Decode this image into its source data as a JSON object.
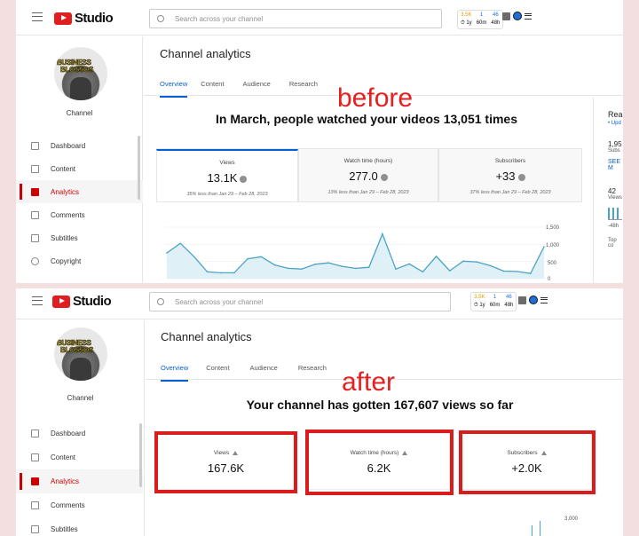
{
  "brand": {
    "logo_text": "Studio"
  },
  "search": {
    "placeholder": "Search across your channel"
  },
  "header_stats": {
    "col1": {
      "value": "3.5K",
      "sub": "⏱ 1y"
    },
    "col2": {
      "value": "1",
      "sub": "60m"
    },
    "col3": {
      "value": "46",
      "sub": "48h"
    }
  },
  "sidebar": {
    "channel_label": "Channel",
    "channel_art": {
      "line1": "BUSINESS",
      "line2": "BLOSSOS"
    },
    "items_before": [
      {
        "label": "Dashboard",
        "icon": "dashboard-icon"
      },
      {
        "label": "Content",
        "icon": "content-icon"
      },
      {
        "label": "Analytics",
        "icon": "analytics-icon",
        "active": true
      },
      {
        "label": "Comments",
        "icon": "comments-icon"
      },
      {
        "label": "Subtitles",
        "icon": "subtitles-icon"
      },
      {
        "label": "Copyright",
        "icon": "copyright-icon"
      }
    ],
    "items_after": [
      {
        "label": "Dashboard",
        "icon": "dashboard-icon"
      },
      {
        "label": "Content",
        "icon": "content-icon"
      },
      {
        "label": "Analytics",
        "icon": "analytics-icon",
        "active": true
      },
      {
        "label": "Comments",
        "icon": "comments-icon"
      },
      {
        "label": "Subtitles",
        "icon": "subtitles-icon"
      }
    ]
  },
  "page": {
    "title": "Channel analytics"
  },
  "tabs": [
    "Overview",
    "Content",
    "Audience",
    "Research"
  ],
  "before": {
    "annotation": "before",
    "headline": "In March, people watched your videos 13,051 times",
    "cards": [
      {
        "label": "Views",
        "value": "13.1K",
        "sub": "35% less than Jan 29 – Feb 28, 2023"
      },
      {
        "label": "Watch time (hours)",
        "value": "277.0",
        "sub": "13% less than Jan 29 – Feb 28, 2023"
      },
      {
        "label": "Subscribers",
        "value": "+33",
        "sub": "37% less than Jan 29 – Feb 28, 2023"
      }
    ],
    "y_ticks": [
      "1,500",
      "1,000",
      "500",
      "0"
    ],
    "right_panel": {
      "title": "Rea",
      "line1": "• Upd",
      "value1": "1,95",
      "label1": "Subs",
      "link": "SEE M",
      "value2": "42",
      "label2": "Views",
      "foot1": "-48h",
      "foot2": "Top co"
    }
  },
  "after": {
    "annotation": "after",
    "headline": "Your channel has gotten 167,607 views so far",
    "cards": [
      {
        "label": "Views",
        "value": "167.6K"
      },
      {
        "label": "Watch time (hours)",
        "value": "6.2K"
      },
      {
        "label": "Subscribers",
        "value": "+2.0K"
      }
    ],
    "y_tick": "3,000"
  },
  "chart_data": {
    "type": "line",
    "y_range": [
      0,
      1500
    ],
    "values": [
      750,
      1030,
      650,
      200,
      170,
      170,
      580,
      640,
      400,
      300,
      280,
      420,
      460,
      360,
      300,
      330,
      1300,
      280,
      430,
      200,
      650,
      230,
      510,
      490,
      380,
      220,
      210,
      150,
      930
    ],
    "color": "#4ba3c7",
    "fill": "#dff0f7"
  }
}
